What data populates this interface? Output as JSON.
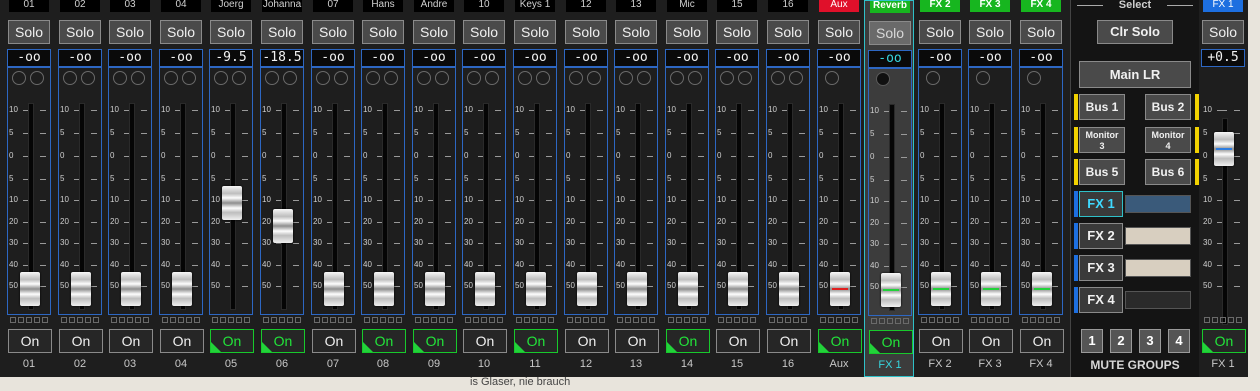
{
  "strips": [
    {
      "name": "01",
      "level": "-oo",
      "fader": 0,
      "on": false,
      "num": "01"
    },
    {
      "name": "02",
      "level": "-oo",
      "fader": 0,
      "on": false,
      "num": "02"
    },
    {
      "name": "03",
      "level": "-oo",
      "fader": 0,
      "on": false,
      "num": "03"
    },
    {
      "name": "04",
      "level": "-oo",
      "fader": 0,
      "on": false,
      "num": "04"
    },
    {
      "name": "Joerg",
      "level": "-9.5",
      "fader": 0.51,
      "on": true,
      "num": "05"
    },
    {
      "name": "Johanna",
      "level": "-18.5",
      "fader": 0.37,
      "on": true,
      "num": "06"
    },
    {
      "name": "07",
      "level": "-oo",
      "fader": 0,
      "on": false,
      "num": "07"
    },
    {
      "name": "Hans",
      "level": "-oo",
      "fader": 0,
      "on": true,
      "num": "08"
    },
    {
      "name": "Andre",
      "level": "-oo",
      "fader": 0,
      "on": true,
      "num": "09"
    },
    {
      "name": "10",
      "level": "-oo",
      "fader": 0,
      "on": false,
      "num": "10"
    },
    {
      "name": "Keys 1",
      "level": "-oo",
      "fader": 0,
      "on": true,
      "num": "11"
    },
    {
      "name": "12",
      "level": "-oo",
      "fader": 0,
      "on": false,
      "num": "12"
    },
    {
      "name": "13",
      "level": "-oo",
      "fader": 0,
      "on": false,
      "num": "13"
    },
    {
      "name": "Mic",
      "level": "-oo",
      "fader": 0,
      "on": true,
      "num": "14"
    },
    {
      "name": "15",
      "level": "-oo",
      "fader": 0,
      "on": false,
      "num": "15"
    },
    {
      "name": "16",
      "level": "-oo",
      "fader": 0,
      "on": false,
      "num": "16"
    },
    {
      "name": "Aux",
      "level": "-oo",
      "fader": 0,
      "on": true,
      "num": "Aux",
      "tag": "red",
      "stripe": "#e02020",
      "singleDot": true
    },
    {
      "name": "Reverb",
      "level": "-oo",
      "fader": 0,
      "on": true,
      "num": "FX 1",
      "tag": "green",
      "stripe": "#22d23a",
      "selected": true,
      "singleDot": true
    },
    {
      "name": "FX 2",
      "level": "-oo",
      "fader": 0,
      "on": false,
      "num": "FX 2",
      "tag": "green",
      "stripe": "#22d23a",
      "singleDot": true
    },
    {
      "name": "FX 3",
      "level": "-oo",
      "fader": 0,
      "on": false,
      "num": "FX 3",
      "tag": "green",
      "stripe": "#22d23a",
      "singleDot": true
    },
    {
      "name": "FX 4",
      "level": "-oo",
      "fader": 0,
      "on": false,
      "num": "FX 4",
      "tag": "green",
      "stripe": "#22d23a",
      "singleDot": true
    }
  ],
  "solo_label": "Solo",
  "on_label": "On",
  "scale_labels": [
    "10",
    "5",
    "0",
    "5",
    "10",
    "20",
    "30",
    "40",
    "50"
  ],
  "select_panel": {
    "title": "Select",
    "clr_solo": "Clr Solo",
    "main": "Main LR",
    "buses": [
      "Bus 1",
      "Bus 2",
      "Monitor 3",
      "Monitor 4",
      "Bus 5",
      "Bus 6"
    ],
    "fx": [
      "FX 1",
      "FX 2",
      "FX 3",
      "FX 4"
    ],
    "mute_group_buttons": [
      "1",
      "2",
      "3",
      "4"
    ],
    "mute_groups_title": "MUTE GROUPS"
  },
  "fx_master": {
    "name": "FX 1",
    "level": "+0.5",
    "fader": 0.83,
    "on": true,
    "num": "FX 1"
  },
  "colors": {
    "accent_cyan": "#2fc0c8",
    "on_green": "#22d23a",
    "frame_blue": "#2d67c3",
    "bus_yellow": "#f2d200"
  },
  "ghost_text": "is Glaser, nie brauch"
}
